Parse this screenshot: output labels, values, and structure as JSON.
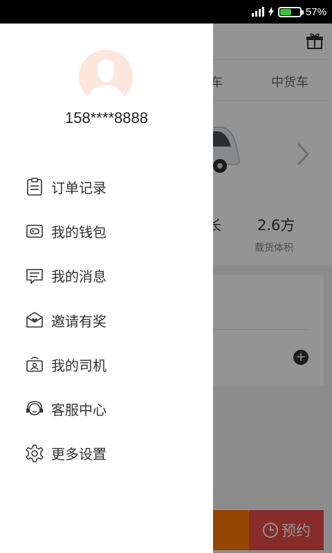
{
  "status_bar": {
    "battery_percent": "57%",
    "battery_level": 0.57
  },
  "background": {
    "tabs": [
      "车",
      "中货车"
    ],
    "spec_partial": "长",
    "spec_value": "2.6方",
    "spec_label": "载货体积",
    "book_label": "预约"
  },
  "drawer": {
    "phone": "158****8888",
    "menu": [
      {
        "label": "订单记录",
        "icon": "clipboard-icon"
      },
      {
        "label": "我的钱包",
        "icon": "wallet-icon"
      },
      {
        "label": "我的消息",
        "icon": "message-icon"
      },
      {
        "label": "邀请有奖",
        "icon": "invite-envelope-icon"
      },
      {
        "label": "我的司机",
        "icon": "driver-icon"
      },
      {
        "label": "客服中心",
        "icon": "customer-service-icon"
      },
      {
        "label": "更多设置",
        "icon": "gear-icon"
      }
    ]
  }
}
